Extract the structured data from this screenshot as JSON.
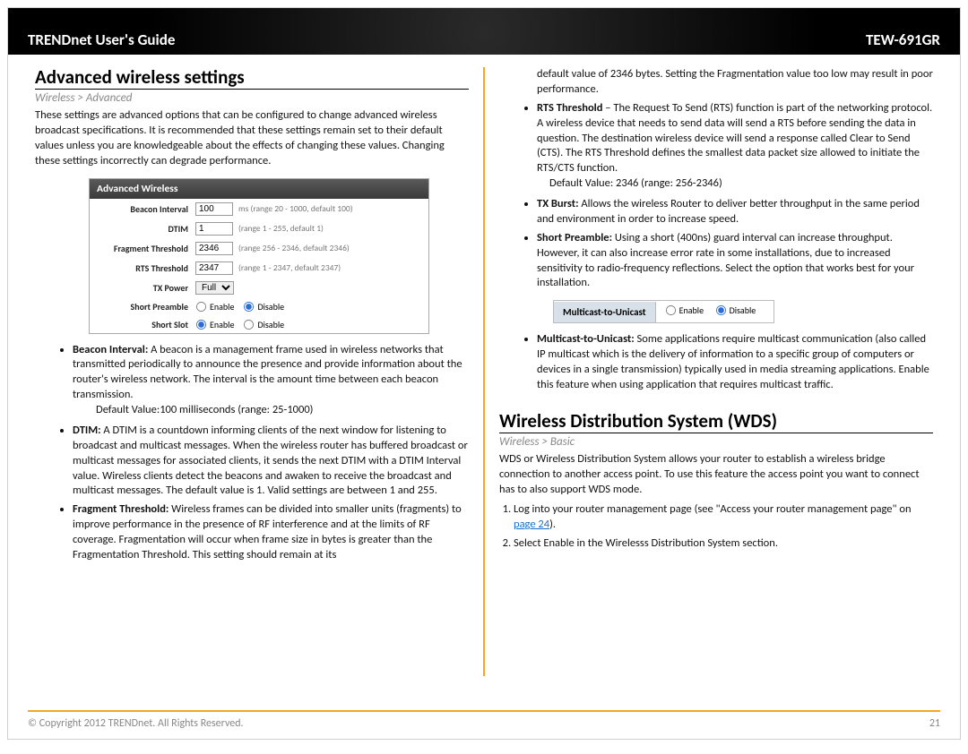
{
  "header": {
    "left": "TRENDnet User's Guide",
    "right": "TEW-691GR"
  },
  "left_col": {
    "h2": "Advanced wireless settings",
    "breadcrumb": "Wireless > Advanced",
    "intro": "These settings are advanced options that can be configured to change advanced wireless broadcast specifications. It is recommended that these settings remain set to their default values unless you are knowledgeable about the effects of changing these values. Changing these settings incorrectly can degrade performance.",
    "panel_title": "Advanced Wireless",
    "rows": {
      "beacon": {
        "label": "Beacon Interval",
        "value": "100",
        "hint": "ms   (range 20 - 1000, default 100)"
      },
      "dtim": {
        "label": "DTIM",
        "value": "1",
        "hint": "(range 1 - 255, default 1)"
      },
      "frag": {
        "label": "Fragment Threshold",
        "value": "2346",
        "hint": "(range 256 - 2346, default 2346)"
      },
      "rts": {
        "label": "RTS Threshold",
        "value": "2347",
        "hint": "(range 1 - 2347, default 2347)"
      },
      "txpower": {
        "label": "TX Power",
        "value": "Full"
      },
      "short_preamble": {
        "label": "Short Preamble",
        "enable": "Enable",
        "disable": "Disable"
      },
      "short_slot": {
        "label": "Short Slot",
        "enable": "Enable",
        "disable": "Disable"
      }
    },
    "bullets": {
      "beacon_head": "Beacon Interval:",
      "beacon_body": " A beacon is a management frame used in wireless networks that transmitted periodically to announce the presence and provide information about the router's wireless network. The interval is the amount time between each beacon transmission.",
      "beacon_default": "Default Value:100 milliseconds (range: 25-1000)",
      "dtim_head": "DTIM:",
      "dtim_body": " A DTIM is a countdown informing clients of the next window for listening to broadcast and multicast messages. When the wireless router has buffered broadcast or multicast messages for associated clients, it sends the next DTIM with a DTIM Interval value. Wireless clients detect the beacons and awaken to receive the broadcast and multicast messages. The default value is 1. Valid settings are between 1 and 255.",
      "frag_head": "Fragment Threshold:",
      "frag_body": " Wireless frames can be divided into smaller units (fragments) to improve performance in the presence of RF interference and at the limits of RF coverage. Fragmentation will occur when frame size in bytes is greater than the Fragmentation Threshold. This setting should remain at its"
    }
  },
  "right_col": {
    "frag_cont": "default value of 2346 bytes. Setting the Fragmentation value too low may result in poor performance.",
    "rts_head": "RTS Threshold",
    "rts_body": " – The Request To Send (RTS) function is part of the networking protocol. A wireless device that needs to send data will send a RTS before sending the data in question. The destination wireless device will send a response called Clear to Send (CTS). The RTS Threshold defines the smallest data packet size allowed to initiate the RTS/CTS function.",
    "rts_default": "Default Value: 2346 (range: 256-2346)",
    "txburst_head": "TX Burst:",
    "txburst_body": " Allows the wireless Router to deliver better throughput in the same period and environment in order to increase speed.",
    "sp_head": "Short Preamble:",
    "sp_body": " Using a short (400ns) guard interval can increase throughput. However, it can also increase error rate in some installations, due to increased sensitivity to radio-frequency reflections. Select the option that works best for your installation.",
    "mc_label": "Multicast-to-Unicast",
    "mc_enable": "Enable",
    "mc_disable": "Disable",
    "mc_head": "Multicast-to-Unicast:",
    "mc_body": " Some applications require multicast communication (also called IP multicast which is the delivery of information to a specific group of computers or devices in a single transmission) typically used in media streaming applications. Enable this feature when using application that requires multicast traffic.",
    "wds_h2": "Wireless Distribution System (WDS)",
    "wds_breadcrumb": "Wireless > Basic",
    "wds_intro": "WDS or Wireless Distribution System allows your router to establish a wireless bridge connection to another access point. To use this feature the access point you want to connect has to also support WDS mode.",
    "step1a": "Log into your router management page (see \"Access your router management page\" on ",
    "step1_link": "page 24",
    "step1b": ").",
    "step2": "Select Enable in the Wirelesss Distribution System section."
  },
  "footer": {
    "copyright": "© Copyright 2012 TRENDnet. All Rights Reserved.",
    "page": "21"
  }
}
